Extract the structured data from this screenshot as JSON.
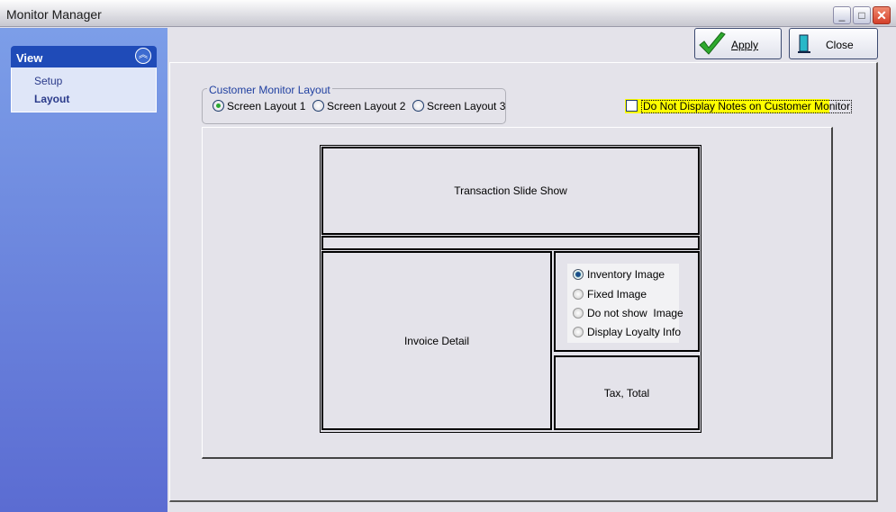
{
  "window": {
    "title": "Monitor Manager",
    "minimize": "_",
    "maximize": "□",
    "close": "✕"
  },
  "sidebar": {
    "section": "View",
    "items": [
      {
        "label": "Setup",
        "active": false
      },
      {
        "label": "Layout",
        "active": true
      }
    ]
  },
  "toolbar": {
    "apply": "Apply",
    "close": "Close"
  },
  "layout_group": {
    "label": "Customer Monitor Layout",
    "options": [
      "Screen Layout 1",
      "Screen Layout 2",
      "Screen Layout 3"
    ],
    "selected": "Screen Layout 1"
  },
  "notes_checkbox": {
    "label": "Do Not Display Notes on Customer Monitor",
    "checked": false,
    "highlight": "#ffff00"
  },
  "diagram": {
    "slideshow": "Transaction Slide Show",
    "invoice": "Invoice Detail",
    "tax": "Tax, Total",
    "image_options": [
      "Inventory Image",
      "Fixed Image",
      "Do not show  Image",
      "Display Loyalty Info"
    ],
    "image_selected": "Inventory Image"
  }
}
